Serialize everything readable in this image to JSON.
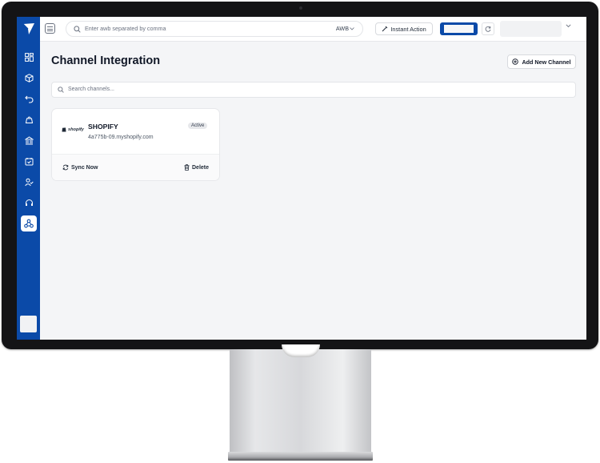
{
  "topbar": {
    "awb_search_placeholder": "Enter awb separated by comma",
    "awb_type": "AWB",
    "instant_action_label": "Instant Action"
  },
  "sidebar": {
    "items": [
      {
        "icon": "dashboard-icon"
      },
      {
        "icon": "package-icon"
      },
      {
        "icon": "returns-icon"
      },
      {
        "icon": "shopping-bag-icon"
      },
      {
        "icon": "bank-icon"
      },
      {
        "icon": "calendar-box-icon"
      },
      {
        "icon": "user-check-icon"
      },
      {
        "icon": "headset-icon"
      },
      {
        "icon": "webhook-icon",
        "active": true
      }
    ]
  },
  "page": {
    "title": "Channel Integration",
    "add_channel_label": "Add New Channel",
    "search_placeholder": "Search channels..."
  },
  "channels": [
    {
      "logo_text": "shopify",
      "name": "SHOPIFY",
      "url": "4a775b-09.myshopify.com",
      "status": "Active",
      "sync_label": "Sync Now",
      "delete_label": "Delete"
    }
  ],
  "colors": {
    "brand": "#0b4aa8",
    "background": "#f4f5f7"
  }
}
